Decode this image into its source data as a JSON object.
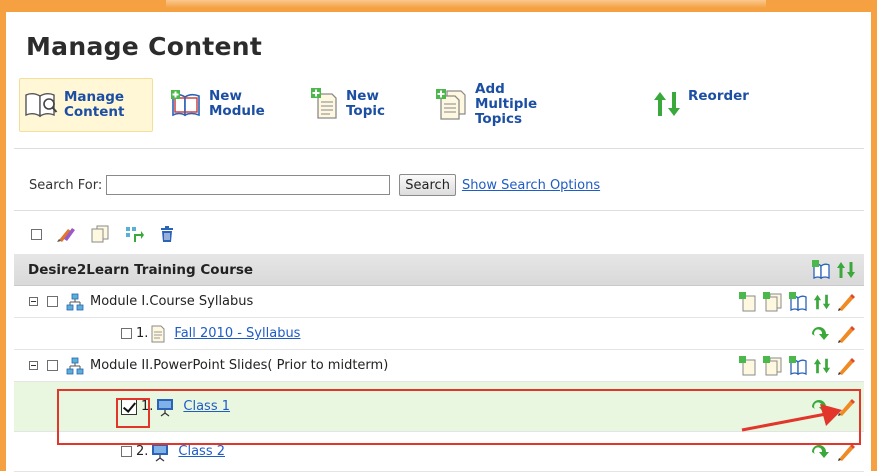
{
  "page": {
    "title": "Manage Content"
  },
  "toolbar": {
    "manage_content": "Manage\nContent",
    "new_module": "New\nModule",
    "new_topic": "New\nTopic",
    "add_multiple_topics": "Add\nMultiple Topics",
    "reorder": "Reorder"
  },
  "search": {
    "label": "Search For:",
    "value": "",
    "placeholder": "",
    "button": "Search",
    "options_link": "Show Search Options"
  },
  "tree": {
    "course": "Desire2Learn Training Course",
    "module1": {
      "label": "Module I.Course Syllabus"
    },
    "module1_topic1": {
      "num": "1.",
      "label": "Fall 2010 - Syllabus"
    },
    "module2": {
      "label": "Module II.PowerPoint Slides( Prior to midterm)"
    },
    "module2_topic1": {
      "num": "1.",
      "label": "Class 1"
    },
    "module2_topic2": {
      "num": "2.",
      "label": "Class 2"
    }
  },
  "colors": {
    "frame": "#f5a142",
    "link": "#1f5cc5",
    "toolbar_text": "#1c4fa3",
    "highlight": "#e2362a",
    "selected_row": "#e9f6e0"
  }
}
